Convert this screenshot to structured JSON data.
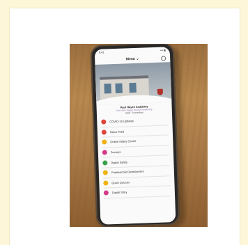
{
  "phone": {
    "status_time": "9:41",
    "status_signal": "••• ▮",
    "nav_title": "Menu ⌄"
  },
  "school": {
    "name": "Paul Hayes Academy",
    "tagline": "Part of the Galaxy Schools Partnership",
    "role": "Staff - Secondary"
  },
  "menu_items": [
    {
      "label": "COVID-19 Updates",
      "color": "#e0443b",
      "icon": "virus-icon"
    },
    {
      "label": "News Feed",
      "color": "#e0443b",
      "icon": "news-icon"
    },
    {
      "label": "Online Safety Centre",
      "color": "#f1b312",
      "icon": "shield-icon"
    },
    {
      "label": "Surveys",
      "color": "#d33a8a",
      "icon": "survey-icon"
    },
    {
      "label": "Digital Safety",
      "color": "#3aa24a",
      "icon": "lock-icon"
    },
    {
      "label": "Professional Development",
      "color": "#f1b312",
      "icon": "cap-icon"
    },
    {
      "label": "Quick Quizzes",
      "color": "#f1b312",
      "icon": "quiz-icon"
    },
    {
      "label": "Digital Story",
      "color": "#d33a8a",
      "icon": "book-icon"
    }
  ]
}
